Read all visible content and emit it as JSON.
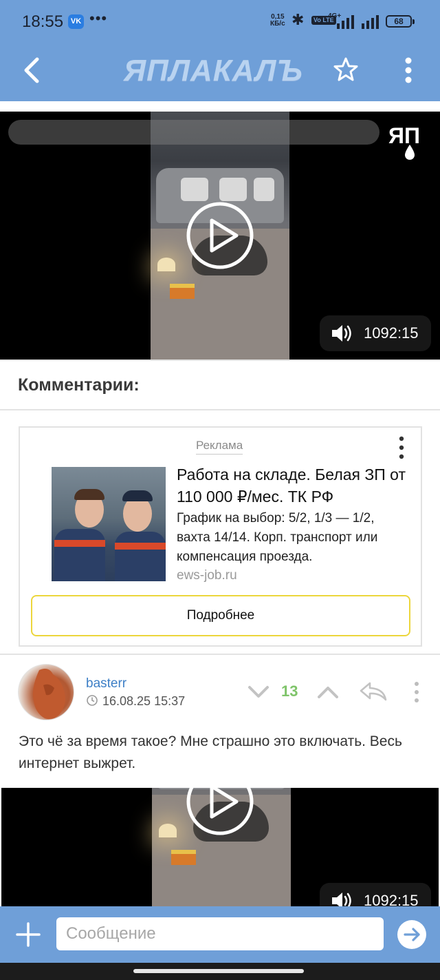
{
  "status_bar": {
    "time": "18:55",
    "vk_badge": "VK",
    "more_dots": "•••",
    "speed_value": "0,15",
    "speed_unit": "КБ/с",
    "network": "4G+",
    "volte": "Vo LTE",
    "battery": "68"
  },
  "header": {
    "logo": "ЯПЛАКАЛЪ",
    "accent_color": "#6f9fd8"
  },
  "video": {
    "duration": "1092:15",
    "overlay_logo": "ЯП"
  },
  "comments": {
    "title": "Комментарии:"
  },
  "ad": {
    "label": "Реклама",
    "title": "Работа на складе. Белая ЗП от 110 000 ₽/мес. ТК РФ",
    "text": "График на выбор: 5/2, 1/3 — 1/2, вахта 14/14. Корп. транспорт или компенсация проезда.",
    "domain": "ews-job.ru",
    "button": "Подробнее"
  },
  "comment": {
    "author": "basterr",
    "date": "16.08.25 15:37",
    "score": "13",
    "text": "Это чё за время такое? Мне страшно это включать. Весь интернет выжрет."
  },
  "video2": {
    "duration": "1092:15"
  },
  "input": {
    "placeholder": "Сообщение"
  }
}
